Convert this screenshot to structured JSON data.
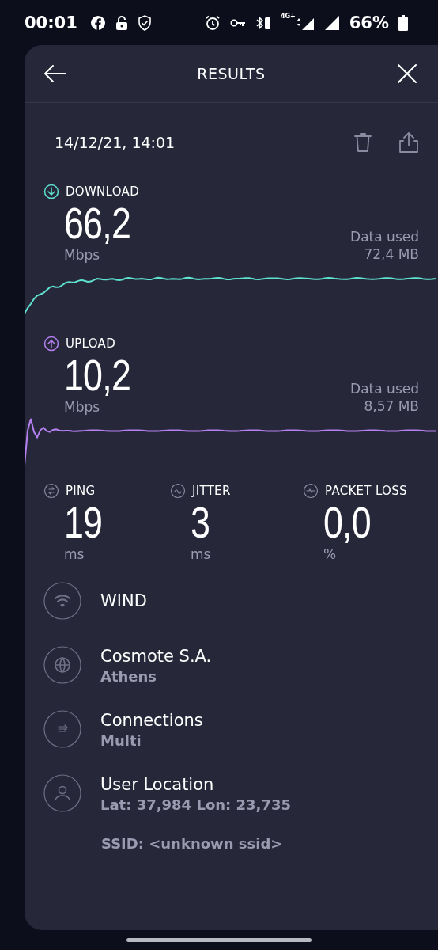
{
  "status_bar": {
    "time": "00:01",
    "network_label": "4G+",
    "battery": "66%"
  },
  "header": {
    "title": "RESULTS"
  },
  "result": {
    "date": "14/12/21, 14:01"
  },
  "tests": [
    {
      "kind": "download",
      "label": "DOWNLOAD",
      "value": "66,2",
      "unit": "Mbps",
      "data_used_label": "Data used",
      "data_used": "72,4 MB",
      "color": "#5fe3d1"
    },
    {
      "kind": "upload",
      "label": "UPLOAD",
      "value": "10,2",
      "unit": "Mbps",
      "data_used_label": "Data used",
      "data_used": "8,57 MB",
      "color": "#b581f2"
    }
  ],
  "metrics": [
    {
      "kind": "ping",
      "label": "PING",
      "value": "19",
      "unit": "ms"
    },
    {
      "kind": "jitter",
      "label": "JITTER",
      "value": "3",
      "unit": "ms"
    },
    {
      "kind": "packet_loss",
      "label": "PACKET LOSS",
      "value": "0,0",
      "unit": "%"
    }
  ],
  "info": [
    {
      "kind": "wifi",
      "title": "WIND"
    },
    {
      "kind": "globe",
      "title": "Cosmote S.A.",
      "subtitle": "Athens"
    },
    {
      "kind": "connections",
      "title": "Connections",
      "subtitle": "Multi"
    },
    {
      "kind": "user",
      "title": "User Location",
      "subtitle": "Lat: 37,984 Lon: 23,735"
    }
  ],
  "ssid": "SSID: <unknown ssid>"
}
